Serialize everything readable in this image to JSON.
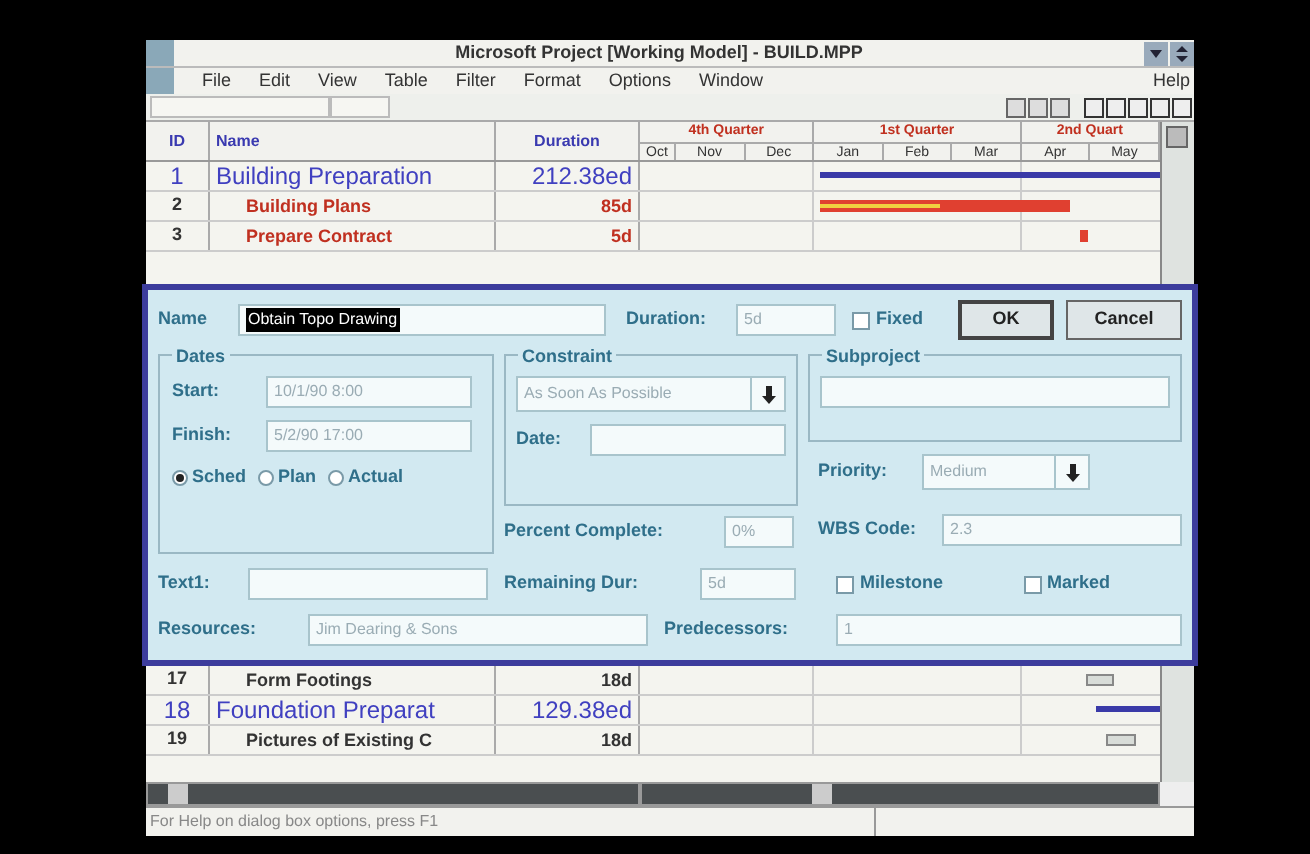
{
  "window": {
    "title": "Microsoft Project [Working Model] - BUILD.MPP"
  },
  "menu": [
    {
      "label": "File"
    },
    {
      "label": "Edit"
    },
    {
      "label": "View"
    },
    {
      "label": "Table"
    },
    {
      "label": "Filter"
    },
    {
      "label": "Format"
    },
    {
      "label": "Options"
    },
    {
      "label": "Window"
    },
    {
      "label": "Help"
    }
  ],
  "table": {
    "columns": [
      "ID",
      "Name",
      "Duration"
    ],
    "quarters": [
      "4th Quarter",
      "1st Quarter",
      "2nd Quart"
    ],
    "months": [
      "Oct",
      "Nov",
      "Dec",
      "Jan",
      "Feb",
      "Mar",
      "Apr",
      "May"
    ],
    "rows_top": [
      {
        "id": "1",
        "name": "Building Preparation",
        "duration": "212.38ed",
        "kind": "summary"
      },
      {
        "id": "2",
        "name": "Building Plans",
        "duration": "85d",
        "kind": "critical"
      },
      {
        "id": "3",
        "name": "Prepare Contract",
        "duration": "5d",
        "kind": "critical"
      }
    ],
    "rows_bottom": [
      {
        "id": "17",
        "name": "Form Footings",
        "duration": "18d",
        "kind": "task"
      },
      {
        "id": "18",
        "name": "Foundation Preparat",
        "duration": "129.38ed",
        "kind": "summary"
      },
      {
        "id": "19",
        "name": "Pictures of Existing C",
        "duration": "18d",
        "kind": "task"
      }
    ]
  },
  "dialog": {
    "name_label": "Name",
    "name_value": "Obtain Topo Drawing",
    "duration_label": "Duration:",
    "duration_value": "5d",
    "fixed": {
      "label": "Fixed",
      "checked": false
    },
    "ok": "OK",
    "cancel": "Cancel",
    "dates": {
      "title": "Dates",
      "start_label": "Start:",
      "start_value": "10/1/90 8:00",
      "finish_label": "Finish:",
      "finish_value": "5/2/90 17:00",
      "options": [
        {
          "label": "Sched",
          "selected": true
        },
        {
          "label": "Plan",
          "selected": false
        },
        {
          "label": "Actual",
          "selected": false
        }
      ]
    },
    "constraint": {
      "title": "Constraint",
      "type_value": "As Soon As Possible",
      "date_label": "Date:"
    },
    "subproject": {
      "title": "Subproject"
    },
    "priority_label": "Priority:",
    "priority_value": "Medium",
    "percent_label": "Percent Complete:",
    "percent_value": "0%",
    "wbs_label": "WBS Code:",
    "wbs_value": "2.3",
    "text1_label": "Text1:",
    "remaining_label": "Remaining Dur:",
    "remaining_value": "5d",
    "milestone": {
      "label": "Milestone",
      "checked": false
    },
    "marked": {
      "label": "Marked",
      "checked": false
    },
    "resources_label": "Resources:",
    "resources_value": "Jim Dearing & Sons",
    "predecessors_label": "Predecessors:",
    "predecessors_value": "1"
  },
  "status_bar": "For Help on dialog box options, press F1"
}
